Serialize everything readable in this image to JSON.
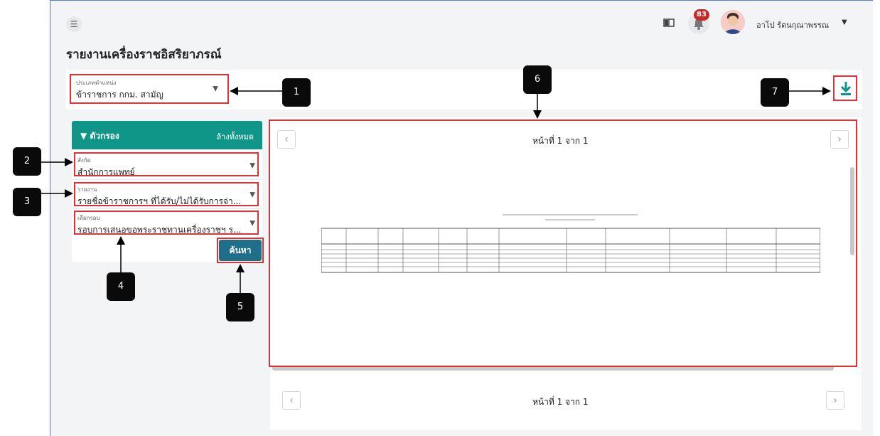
{
  "header": {
    "user_name": "อาโป รัตนกุณาพรรณ",
    "notification_count": "83"
  },
  "page_title": "รายงานเครื่องราชอิสริยาภรณ์",
  "position_type": {
    "label": "ประเภทตำแหน่ง",
    "value": "ข้าราชการ กกม. สามัญ"
  },
  "filter": {
    "title": "ตัวกรอง",
    "clear_all": "ล้างทั้งหมด",
    "department": {
      "label": "สังกัด",
      "value": "สำนักการแพทย์"
    },
    "report": {
      "label": "รายงาน",
      "value": "รายชื่อข้าราชการฯ ที่ได้รับ/ไม่ได้รับการจ่า..."
    },
    "round": {
      "label": "เลือกรอบ",
      "value": "รอบการเสนอขอพระราชทานเครื่องราชฯ ร..."
    },
    "search_label": "ค้นหา"
  },
  "viewer": {
    "page_indicator_top": "หน้าที่ 1 จาก 1",
    "page_indicator_bottom": "หน้าที่ 1 จาก 1"
  },
  "annotations": [
    "1",
    "2",
    "3",
    "4",
    "5",
    "6",
    "7"
  ],
  "colors": {
    "accent": "#0f9688",
    "button": "#1f6f8b",
    "highlight": "#e0303a",
    "badge": "#c62828"
  }
}
